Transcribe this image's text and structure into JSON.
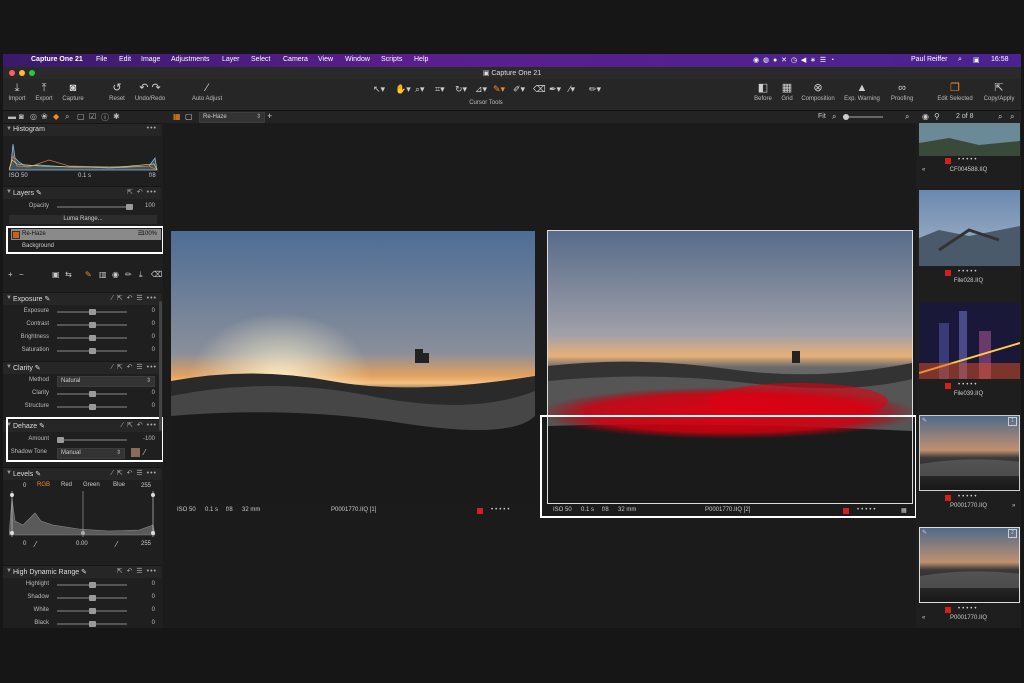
{
  "menubar": {
    "app": "Capture One 21",
    "items": [
      "File",
      "Edit",
      "Image",
      "Adjustments",
      "Layer",
      "Select",
      "Camera",
      "View",
      "Window",
      "Scripts",
      "Help"
    ],
    "user": "Paul Reiffer",
    "clock": "16:58"
  },
  "window_title": "Capture One 21",
  "toolbar": {
    "import": "Import",
    "export": "Export",
    "capture": "Capture",
    "reset": "Reset",
    "undo_redo": "Undo/Redo",
    "auto_adjust": "Auto Adjust",
    "cursor_tools": "Cursor Tools",
    "before": "Before",
    "grid": "Grid",
    "composition": "Composition",
    "exp_warning": "Exp. Warning",
    "proofing": "Proofing",
    "edit_selected": "Edit Selected",
    "copy_apply": "Copy/Apply"
  },
  "histogram": {
    "title": "Histogram",
    "iso": "ISO 50",
    "shutter": "0.1 s",
    "aperture": "f/8"
  },
  "layers": {
    "title": "Layers",
    "opacity_label": "Opacity",
    "opacity_value": "100",
    "opacity_pos": 1.0,
    "luma_range": "Luma Range...",
    "items": [
      {
        "name": "Re-Haze",
        "opacity": "100%"
      },
      {
        "name": "Background"
      }
    ]
  },
  "exposure": {
    "title": "Exposure",
    "rows": [
      {
        "name": "Exposure",
        "value": "0",
        "pos": 0.5
      },
      {
        "name": "Contrast",
        "value": "0",
        "pos": 0.5
      },
      {
        "name": "Brightness",
        "value": "0",
        "pos": 0.5
      },
      {
        "name": "Saturation",
        "value": "0",
        "pos": 0.5
      }
    ]
  },
  "clarity": {
    "title": "Clarity",
    "method_label": "Method",
    "method_value": "Natural",
    "rows": [
      {
        "name": "Clarity",
        "value": "0",
        "pos": 0.5
      },
      {
        "name": "Structure",
        "value": "0",
        "pos": 0.5
      }
    ]
  },
  "dehaze": {
    "title": "Dehaze",
    "amount_label": "Amount",
    "amount_value": "-100",
    "amount_pos": 0.0,
    "shadow_tone_label": "Shadow Tone",
    "shadow_tone_value": "Manual",
    "swatch": "#8a6a58"
  },
  "levels": {
    "title": "Levels",
    "left_value": "0",
    "channels": [
      "RGB",
      "Red",
      "Green",
      "Blue"
    ],
    "right_value": "255",
    "bottom_left": "0",
    "mid": "0.00",
    "bottom_right": "255"
  },
  "hdr": {
    "title": "High Dynamic Range",
    "rows": [
      {
        "name": "Highlight",
        "value": "0",
        "pos": 0.5
      },
      {
        "name": "Shadow",
        "value": "0",
        "pos": 0.5
      },
      {
        "name": "White",
        "value": "0",
        "pos": 0.5
      },
      {
        "name": "Black",
        "value": "0",
        "pos": 0.5
      }
    ]
  },
  "viewer": {
    "layer_select": "Re-Haze",
    "fit": "Fit",
    "left_caption": {
      "iso": "ISO 50",
      "shutter": "0.1 s",
      "aperture": "f/8",
      "focal": "32 mm",
      "file": "P0001770.IIQ [1]"
    },
    "right_caption": {
      "iso": "ISO 50",
      "shutter": "0.1 s",
      "aperture": "f/8",
      "focal": "32 mm",
      "file": "P0001770.IIQ [2]"
    }
  },
  "filmstrip": {
    "counter": "2 of 8",
    "thumbs": [
      {
        "name": "CF004588.IIQ"
      },
      {
        "name": "File028.IIQ"
      },
      {
        "name": "File039.IIQ"
      },
      {
        "name": "P0001770.IIQ",
        "badge": "1"
      },
      {
        "name": "P0001770.IIQ",
        "badge": "2"
      }
    ]
  },
  "colors": {
    "accent": "#f28c28",
    "menubar": "#5a1f8c",
    "red_tag": "#d42020"
  }
}
